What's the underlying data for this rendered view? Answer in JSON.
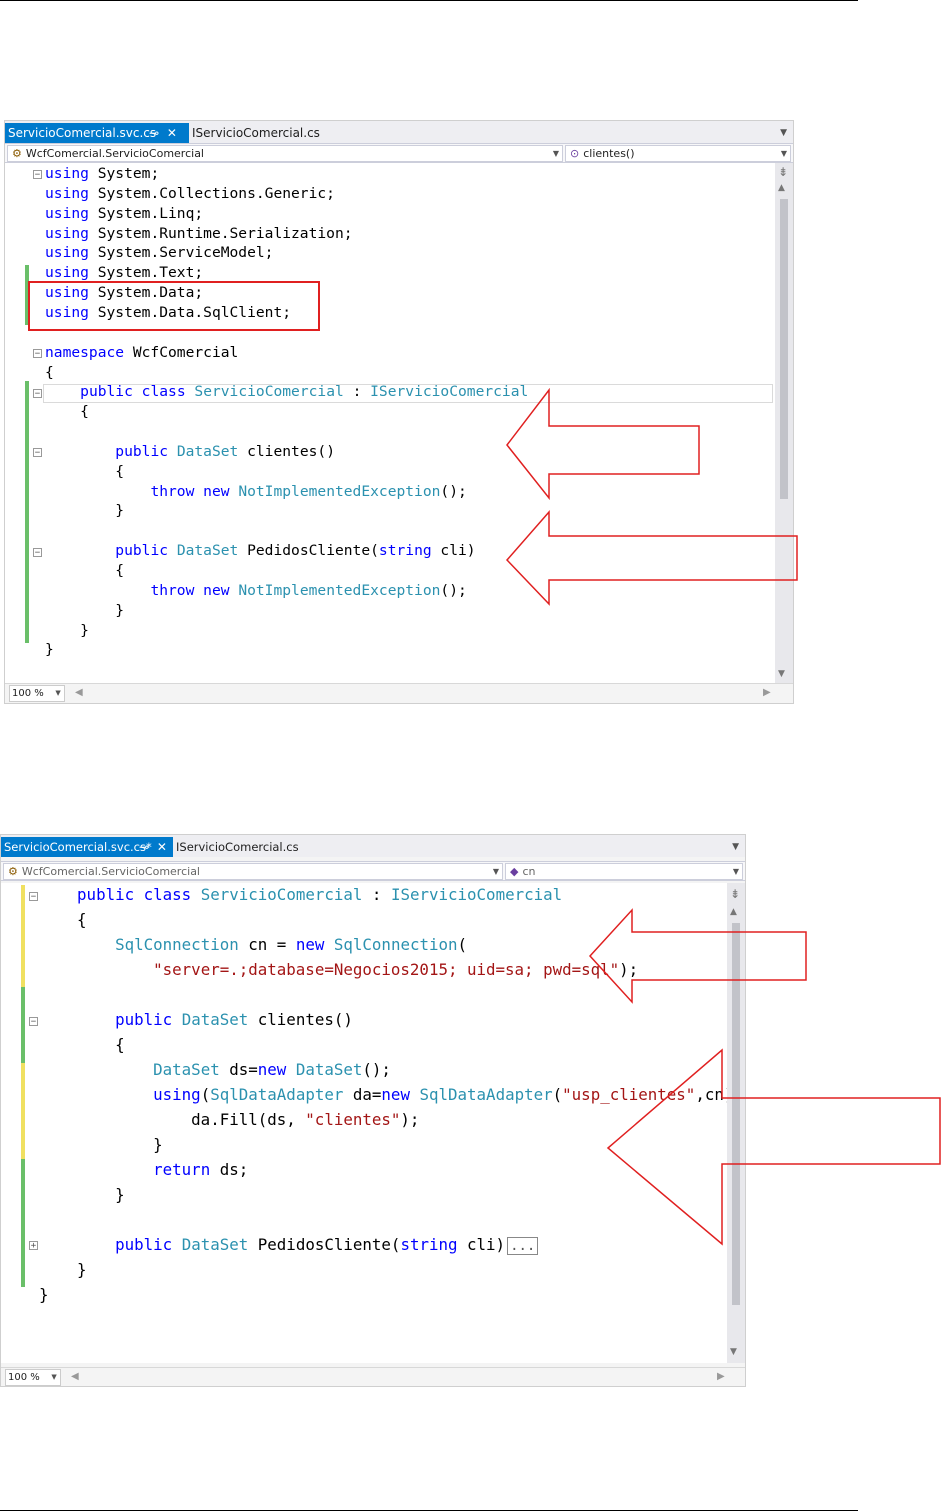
{
  "editor1": {
    "tabs": [
      {
        "label": "ServicioComercial.svc.cs"
      },
      {
        "label": "IServicioComercial.cs"
      }
    ],
    "pin_icon": "pin-icon",
    "close_icon": "close-icon",
    "nav_left": "WcfComercial.ServicioComercial",
    "nav_right": "clientes()",
    "zoom": "100 %",
    "code": [
      "using System;",
      "using System.Collections.Generic;",
      "using System.Linq;",
      "using System.Runtime.Serialization;",
      "using System.ServiceModel;",
      "using System.Text;",
      "using System.Data;",
      "using System.Data.SqlClient;",
      "",
      "namespace WcfComercial",
      "{",
      "    public class ServicioComercial : IServicioComercial",
      "    {",
      "",
      "        public DataSet clientes()",
      "        {",
      "            throw new NotImplementedException();",
      "        }",
      "",
      "        public DataSet PedidosCliente(string cli)",
      "        {",
      "            throw new NotImplementedException();",
      "        }",
      "    }",
      "}"
    ]
  },
  "editor2": {
    "tabs": [
      {
        "label": "ServicioComercial.svc.cs*"
      },
      {
        "label": "IServicioComercial.cs"
      }
    ],
    "nav_left": "WcfComercial.ServicioComercial",
    "nav_right": "cn",
    "zoom": "100 %",
    "code": [
      "    public class ServicioComercial : IServicioComercial",
      "    {",
      "        SqlConnection cn = new SqlConnection(",
      "            \"server=.;database=Negocios2015; uid=sa; pwd=sql\");",
      "",
      "        public DataSet clientes()",
      "        {",
      "            DataSet ds=new DataSet();",
      "            using(SqlDataAdapter da=new SqlDataAdapter(\"usp_clientes\",cn)){",
      "                da.Fill(ds, \"clientes\");",
      "            }",
      "            return ds;",
      "        }",
      "",
      "        public DataSet PedidosCliente(string cli)",
      "    }",
      "}"
    ],
    "collapsed_marker": "..."
  },
  "colors": {
    "keyword": "#0000ff",
    "type": "#2b91af",
    "string": "#a31515",
    "tab_active": "#007acc",
    "annotation_red": "#e02020"
  }
}
